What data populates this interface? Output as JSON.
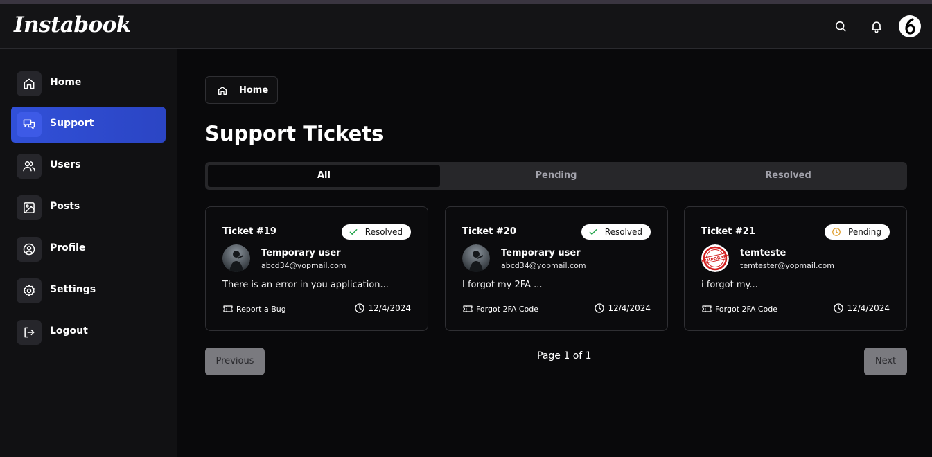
{
  "app": {
    "title": "Instabook"
  },
  "sidebar": {
    "items": [
      {
        "label": "Home",
        "icon": "home-icon"
      },
      {
        "label": "Support",
        "icon": "chat-icon"
      },
      {
        "label": "Users",
        "icon": "users-icon"
      },
      {
        "label": "Posts",
        "icon": "image-icon"
      },
      {
        "label": "Profile",
        "icon": "user-circle-icon"
      },
      {
        "label": "Settings",
        "icon": "gear-icon"
      },
      {
        "label": "Logout",
        "icon": "logout-icon"
      }
    ],
    "active": "Support"
  },
  "breadcrumb": {
    "label": "Home"
  },
  "main": {
    "title": "Support Tickets",
    "tabs": [
      {
        "label": "All"
      },
      {
        "label": "Pending"
      },
      {
        "label": "Resolved"
      }
    ],
    "active_tab": "All"
  },
  "tickets": [
    {
      "number": "Ticket #19",
      "status": "Resolved",
      "user_name": "Temporary user",
      "email": "abcd34@yopmail.com",
      "description": "There is an error in you application...",
      "category": "Report a Bug",
      "date": "12/4/2024"
    },
    {
      "number": "Ticket #20",
      "status": "Resolved",
      "user_name": "Temporary user",
      "email": "abcd34@yopmail.com",
      "description": "I forgot my 2FA ...",
      "category": "Forgot 2FA Code",
      "date": "12/4/2024"
    },
    {
      "number": "Ticket #21",
      "status": "Pending",
      "user_name": "temteste",
      "email": "temtester@yopmail.com",
      "description": "i forgot my...",
      "category": "Forgot 2FA Code",
      "date": "12/4/2024",
      "avatar_stamp_text": "TEMPORARY"
    }
  ],
  "pagination": {
    "previous_label": "Previous",
    "next_label": "Next",
    "page_text": "Page 1 of 1"
  },
  "colors": {
    "accent": "#3150d8",
    "resolved": "#22a34a",
    "pending": "#e0a030"
  }
}
